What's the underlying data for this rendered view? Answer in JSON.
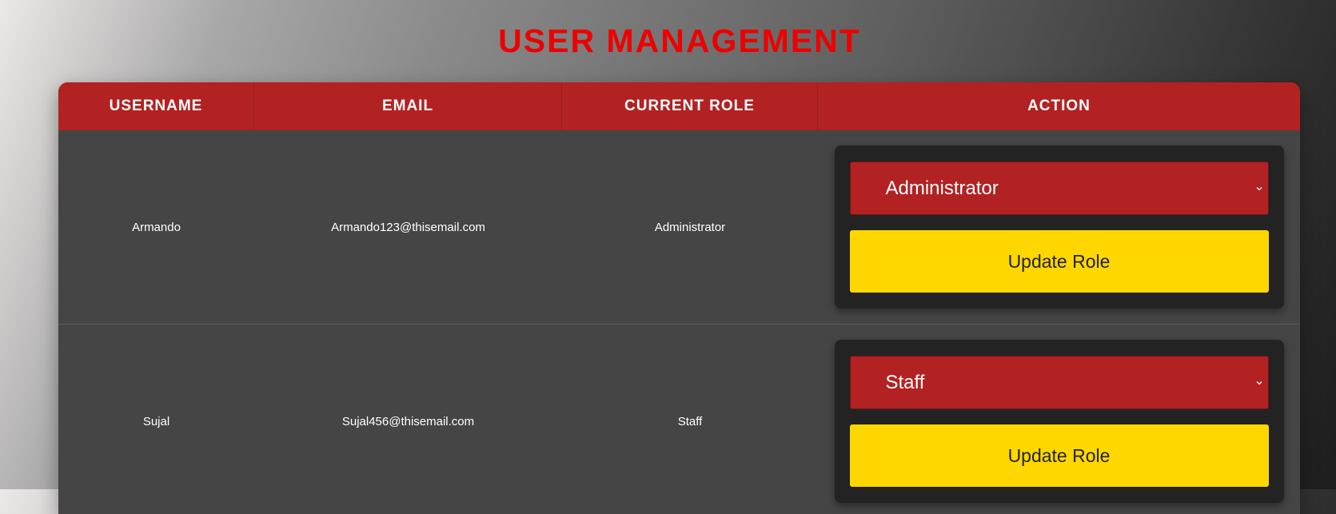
{
  "page": {
    "title": "USER MANAGEMENT"
  },
  "table": {
    "headers": [
      "USERNAME",
      "EMAIL",
      "CURRENT ROLE",
      "ACTION"
    ],
    "rows": [
      {
        "username": "Armando",
        "email": "Armando123@thisemail.com",
        "current_role": "Administrator",
        "selected_role": "Administrator",
        "button_label": "Update Role"
      },
      {
        "username": "Sujal",
        "email": "Sujal456@thisemail.com",
        "current_role": "Staff",
        "selected_role": "Staff",
        "button_label": "Update Role"
      }
    ]
  },
  "colors": {
    "title": "#ee0000",
    "header_bg": "#b22222",
    "row_bg": "#454545",
    "action_box_bg": "#232323",
    "select_bg": "#b22222",
    "button_bg": "#ffd700"
  },
  "icons": {
    "select_arrow": "chevron-down-icon"
  }
}
